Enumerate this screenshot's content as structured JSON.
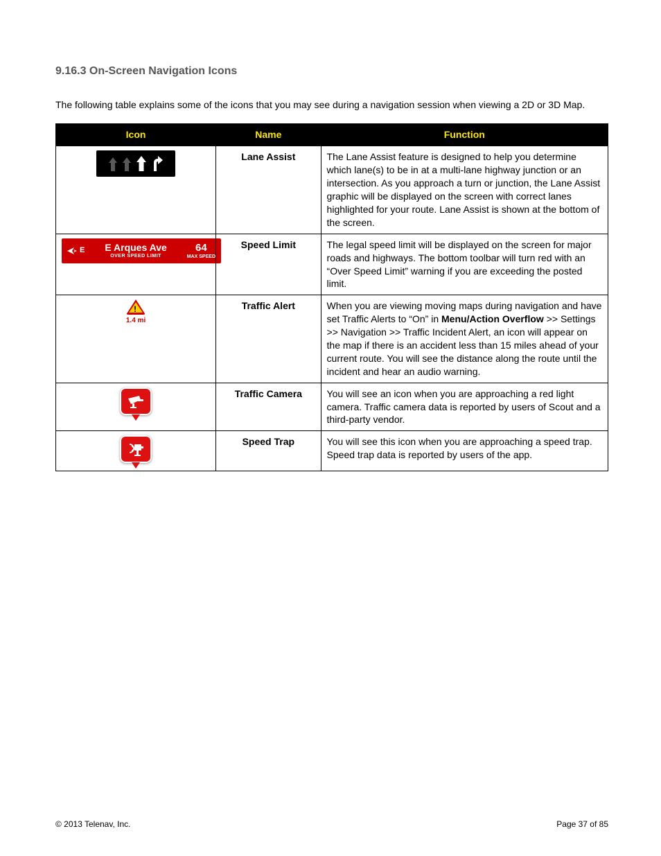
{
  "heading": "9.16.3 On-Screen Navigation Icons",
  "intro": "The following table explains some of the icons that you may see during a navigation session when viewing a 2D or 3D Map.",
  "columns": {
    "icon": "Icon",
    "name": "Name",
    "function": "Function"
  },
  "rows": [
    {
      "id": "lane-assist",
      "name": "Lane Assist",
      "function_html": "The Lane Assist feature is designed to help you determine which lane(s) to be in at a multi-lane highway junction or an intersection. As you approach a turn or junction, the Lane Assist graphic will be displayed on the screen with correct lanes highlighted for your route. Lane Assist is shown at the bottom of the screen."
    },
    {
      "id": "speed-limit",
      "name": "Speed Limit",
      "function_html": "The legal speed limit will be displayed on the screen for major roads and highways. The bottom toolbar will turn red with an “Over Speed Limit” warning if you are exceeding the posted limit.",
      "icon_data": {
        "direction": "E",
        "street": "E Arques Ave",
        "warn": "OVER SPEED LIMIT",
        "speed": "64",
        "speed_label": "MAX SPEED"
      }
    },
    {
      "id": "traffic-alert",
      "name": "Traffic Alert",
      "function_html": "When you are viewing moving maps during navigation and have set Traffic Alerts to “On” in <b>Menu/Action Overflow</b> >> Settings >> Navigation >> Traffic Incident Alert, an icon will appear on the map if there is an accident less than 15 miles ahead of your current route. You will see the distance along the route until the incident and hear an audio warning.",
      "icon_data": {
        "distance": "1.4 mi"
      }
    },
    {
      "id": "traffic-camera",
      "name": "Traffic Camera",
      "function_html": "You will see an icon when you are approaching a red light camera. Traffic camera data is reported by users of Scout and a third-party vendor."
    },
    {
      "id": "speed-trap",
      "name": "Speed Trap",
      "function_html": "You will see this icon when you are approaching a speed trap. Speed trap data is reported by users of the app."
    }
  ],
  "footer": {
    "copyright": "© 2013 Telenav, Inc.",
    "page": "Page 37 of 85"
  }
}
